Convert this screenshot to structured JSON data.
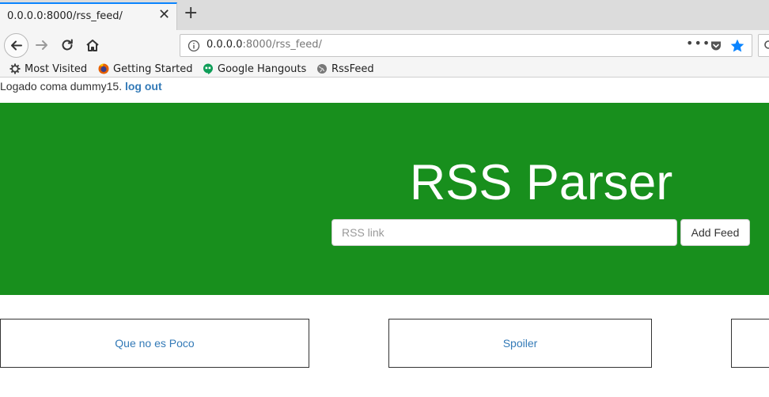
{
  "browser": {
    "tab": {
      "title": "0.0.0.0:8000/rss_feed/",
      "close": "✕"
    },
    "new_tab": "+",
    "url": {
      "host": "0.0.0.0",
      "path": ":8000/rss_feed/"
    },
    "page_actions": "•••",
    "bookmarks": [
      {
        "label": "Most Visited",
        "icon": "gear-icon"
      },
      {
        "label": "Getting Started",
        "icon": "firefox-icon"
      },
      {
        "label": "Google Hangouts",
        "icon": "hangouts-icon"
      },
      {
        "label": "RssFeed",
        "icon": "globe-icon"
      }
    ],
    "colors": {
      "accent": "#0a84ff"
    }
  },
  "page": {
    "login": {
      "text": "Logado coma dummy15. ",
      "logout": "log out"
    },
    "hero": {
      "title": "RSS Parser",
      "input_placeholder": "RSS link",
      "input_value": "",
      "button": "Add Feed",
      "background": "#188f1d"
    },
    "feeds": [
      {
        "title": "Que no es Poco"
      },
      {
        "title": "Spoiler"
      },
      {
        "title": ""
      }
    ],
    "colors": {
      "link": "#337ab7"
    }
  }
}
